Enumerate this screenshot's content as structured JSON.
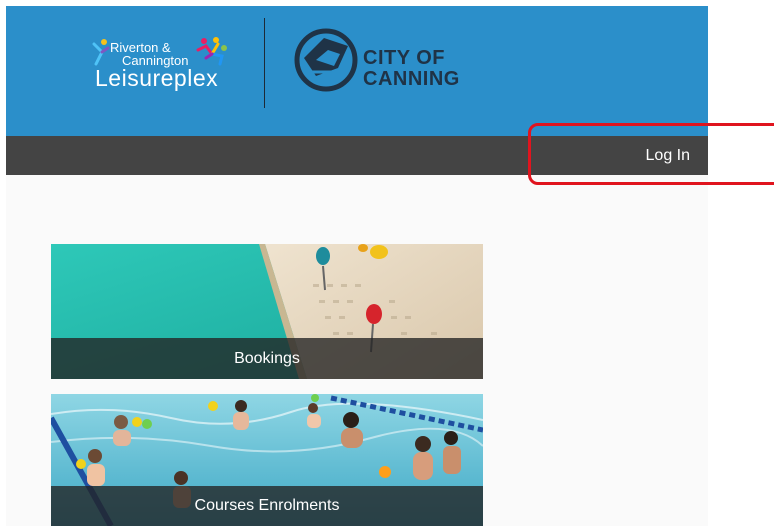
{
  "header": {
    "leisureplex_logo": {
      "line1": "Riverton &",
      "line2": "Cannington",
      "line3": "Leisureplex"
    },
    "canning_logo": {
      "line1": "CITY OF",
      "line2": "CANNING"
    }
  },
  "nav": {
    "login_label": "Log In"
  },
  "tiles": {
    "bookings_label": "Bookings",
    "courses_label": "Courses Enrolments"
  },
  "colors": {
    "header_bg": "#2b8fca",
    "navbar_bg": "#444444",
    "highlight": "#e0141e"
  }
}
